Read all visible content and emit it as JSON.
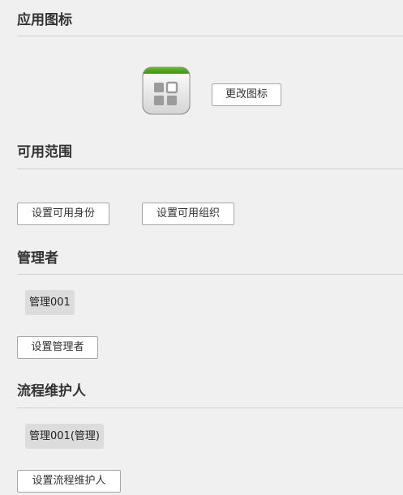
{
  "app_icon_section": {
    "title": "应用图标",
    "change_icon_button": "更改图标",
    "icon_name": "app-grid-icon",
    "icon_accent_color": "#5aaf1e"
  },
  "scope_section": {
    "title": "可用范围",
    "set_identity_button": "设置可用身份",
    "set_org_button": "设置可用组织"
  },
  "admin_section": {
    "title": "管理者",
    "admins": [
      "管理001"
    ],
    "set_admin_button": "设置管理者"
  },
  "maintainer_section": {
    "title": "流程维护人",
    "maintainers": [
      "管理001(管理)"
    ],
    "set_maintainer_button": "设置流程维护人"
  }
}
